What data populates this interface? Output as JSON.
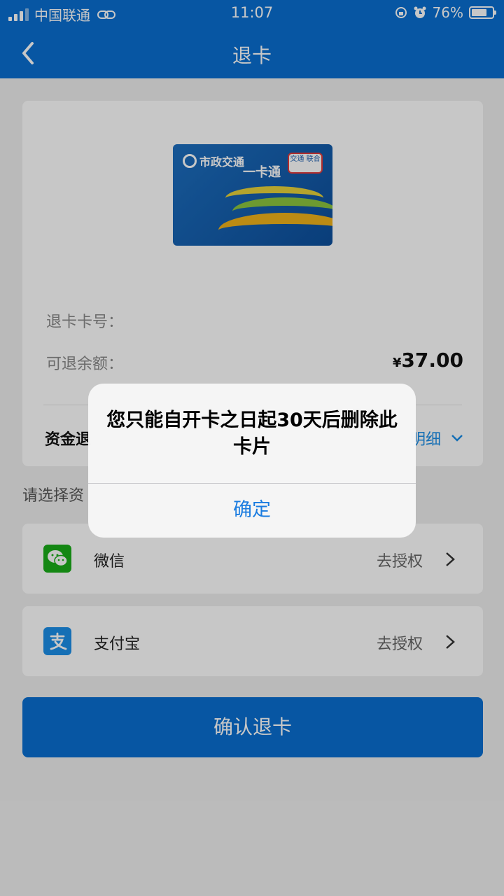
{
  "status_bar": {
    "carrier": "中国联通",
    "time": "11:07",
    "battery": "76%",
    "battery_level": 0.76
  },
  "nav": {
    "title": "退卡"
  },
  "card": {
    "brand": "市政交通",
    "product": "一卡通",
    "badge": "交通 联合"
  },
  "info": {
    "card_number_label": "退卡卡号：",
    "refund_label": "可退余额：",
    "currency": "¥",
    "refund_amount": "37.00",
    "funds_label": "资金退",
    "detail_label": "明细"
  },
  "payment": {
    "choose_label": "请选择资",
    "methods": [
      {
        "name": "微信",
        "action": "去授权",
        "icon": "wechat-icon",
        "color": "#1aad19"
      },
      {
        "name": "支付宝",
        "action": "去授权",
        "icon": "alipay-icon",
        "color": "#1b8fe8"
      }
    ]
  },
  "confirm_button": "确认退卡",
  "dialog": {
    "message": "您只能自开卡之日起30天后删除此卡片",
    "ok_label": "确定"
  },
  "colors": {
    "primary": "#0a6fd1",
    "link": "#1a7ce0"
  }
}
